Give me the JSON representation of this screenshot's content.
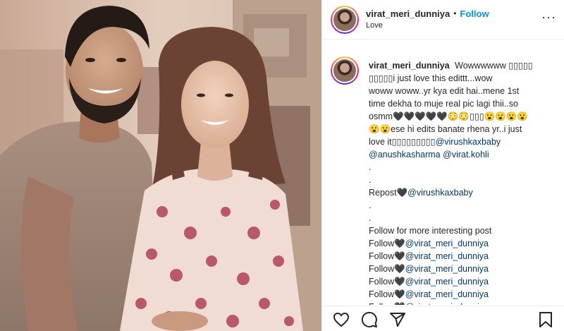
{
  "header": {
    "username": "virat_meri_dunniya",
    "separator": "•",
    "follow_label": "Follow",
    "subtitle": "Love",
    "more_label": "···"
  },
  "caption": {
    "username": "virat_meri_dunniya",
    "lines": [
      {
        "text": "Wowwwwww ▯▯▯▯▯",
        "inline": true
      },
      {
        "text": "▯▯▯▯▯i just love this edittt...wow"
      },
      {
        "text": "woww woww..yr kya edit hai..mene 1st"
      },
      {
        "text": "time dekha to muje real pic lagi thii..so"
      },
      {
        "text": "osmm🖤🖤🖤🖤🖤😳😳▯▯▯😮😮😮😮"
      },
      {
        "text": "😮😮ese hi edits banate rhena yr..i just"
      },
      {
        "text": "love it▯▯▯▯▯▯▯▯▯",
        "mention": "@virushkaxbaby"
      },
      {
        "mention": "@anushkasharma",
        "mention2": "@virat.kohli"
      },
      {
        "text": "."
      },
      {
        "text": "."
      },
      {
        "text": "Repost🖤",
        "mention": "@virushkaxbaby"
      },
      {
        "text": "."
      },
      {
        "text": "."
      },
      {
        "text": "Follow for more interesting post"
      },
      {
        "text": "Follow🖤",
        "mention": "@virat_meri_dunniya"
      },
      {
        "text": "Follow🖤",
        "mention": "@virat_meri_dunniya"
      },
      {
        "text": "Follow🖤",
        "mention": "@virat_meri_dunniya"
      },
      {
        "text": "Follow🖤",
        "mention": "@virat_meri_dunniya"
      },
      {
        "text": "Follow🖤",
        "mention": "@virat_meri_dunniya"
      },
      {
        "text": "Follow🖤",
        "mention": "@virat_meri_dunniya"
      }
    ]
  },
  "actions": {
    "icons": [
      "heart-icon",
      "comment-icon",
      "share-icon",
      "bookmark-icon"
    ]
  },
  "colors": {
    "follow": "#0095f6",
    "mention": "#00376b",
    "text": "#262626",
    "border": "#efefef"
  }
}
